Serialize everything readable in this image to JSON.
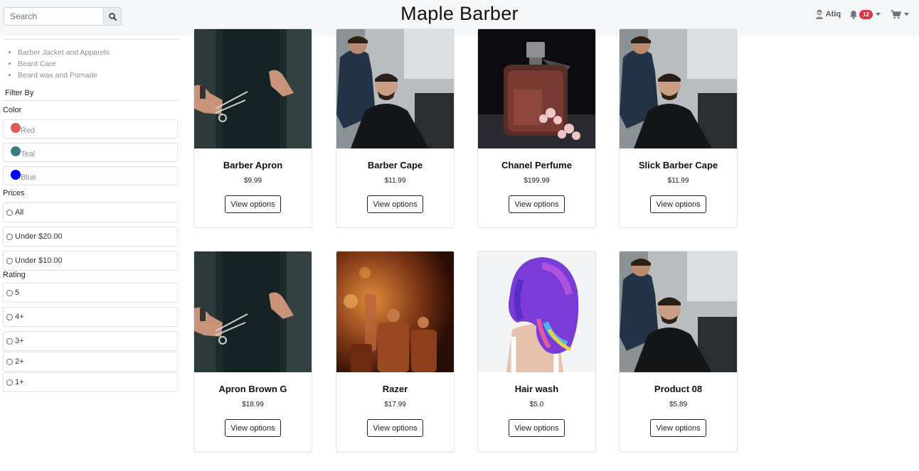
{
  "header": {
    "search_placeholder": "Search",
    "brand": "Maple Barber",
    "user_name": "Atiq",
    "notification_count": "12"
  },
  "sidebar": {
    "categories": [
      "Barber Jacket and Apparels",
      "Beard Care",
      "Beard wax and Pomade"
    ],
    "filter_title": "Filter By",
    "color_title": "Color",
    "colors": [
      {
        "label": "Red",
        "swatch": "#e05a56"
      },
      {
        "label": "Teal",
        "swatch": "#3d7c7c"
      },
      {
        "label": "Blue",
        "swatch": "#0000ff"
      }
    ],
    "prices_title": "Prices",
    "prices": [
      "All",
      "Under $20.00",
      "Under $10.00"
    ],
    "rating_title": "Rating",
    "ratings": [
      "5",
      "4+",
      "3+",
      "2+",
      "1+"
    ]
  },
  "products": [
    {
      "name": "Barber Apron",
      "price": "$9.99",
      "button": "View options",
      "image": "apron"
    },
    {
      "name": "Barber Cape",
      "price": "$11.99",
      "button": "View options",
      "image": "barber"
    },
    {
      "name": "Chanel Perfume",
      "price": "$199.99",
      "button": "View options",
      "image": "perfume"
    },
    {
      "name": "Slick Barber Cape",
      "price": "$11.99",
      "button": "View options",
      "image": "barber"
    },
    {
      "name": "Apron Brown G",
      "price": "$18.99",
      "button": "View options",
      "image": "apron"
    },
    {
      "name": "Razer",
      "price": "$17.99",
      "button": "View options",
      "image": "bottles"
    },
    {
      "name": "Hair wash",
      "price": "$5.0",
      "button": "View options",
      "image": "hair"
    },
    {
      "name": "Product 08",
      "price": "$5.89",
      "button": "View options",
      "image": "barber"
    }
  ]
}
